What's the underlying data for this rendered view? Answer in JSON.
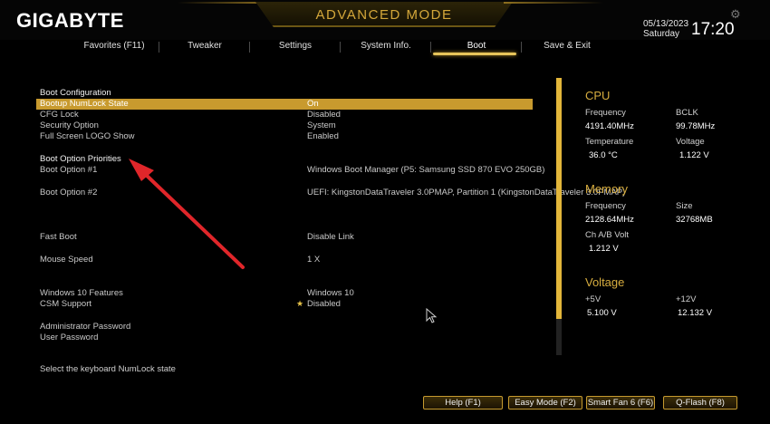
{
  "header": {
    "brand": "GIGABYTE",
    "mode_title": "ADVANCED MODE",
    "date": "05/13/2023",
    "day": "Saturday",
    "time": "17:20"
  },
  "tabs": [
    {
      "label": "Favorites (F11)",
      "active": false
    },
    {
      "label": "Tweaker",
      "active": false
    },
    {
      "label": "Settings",
      "active": false
    },
    {
      "label": "System Info.",
      "active": false
    },
    {
      "label": "Boot",
      "active": true
    },
    {
      "label": "Save & Exit",
      "active": false
    }
  ],
  "boot": {
    "section_config": "Boot Configuration",
    "items": [
      {
        "label": "Bootup NumLock State",
        "value": "On"
      },
      {
        "label": "CFG Lock",
        "value": "Disabled"
      },
      {
        "label": "Security Option",
        "value": "System"
      },
      {
        "label": "Full Screen LOGO Show",
        "value": "Enabled"
      }
    ],
    "section_priorities": "Boot Option Priorities",
    "boot_option_1": {
      "label": "Boot Option #1",
      "value": "Windows Boot Manager (P5: Samsung SSD 870 EVO 250GB)"
    },
    "boot_option_2": {
      "label": "Boot Option #2",
      "value": "UEFI: KingstonDataTraveler 3.0PMAP, Partition 1 (KingstonDataTraveler 3.0PMAP)"
    },
    "fast_boot": {
      "label": "Fast Boot",
      "value": "Disable Link"
    },
    "mouse_speed": {
      "label": "Mouse Speed",
      "value": "1 X"
    },
    "win10_features": {
      "label": "Windows 10 Features",
      "value": "Windows 10"
    },
    "csm_support": {
      "label": "CSM Support",
      "value": "Disabled"
    },
    "admin_password": {
      "label": "Administrator Password"
    },
    "user_password": {
      "label": "User Password"
    }
  },
  "help_text": "Select the keyboard NumLock state",
  "cpu": {
    "title": "CPU",
    "frequency_label": "Frequency",
    "frequency_value": "4191.40MHz",
    "bclk_label": "BCLK",
    "bclk_value": "99.78MHz",
    "temperature_label": "Temperature",
    "temperature_value": "36.0 °C",
    "voltage_label": "Voltage",
    "voltage_value": "1.122 V"
  },
  "memory": {
    "title": "Memory",
    "frequency_label": "Frequency",
    "frequency_value": "2128.64MHz",
    "size_label": "Size",
    "size_value": "32768MB",
    "ch_volt_label": "Ch A/B Volt",
    "ch_volt_value": "1.212 V"
  },
  "voltage": {
    "title": "Voltage",
    "v5_label": "+5V",
    "v5_value": "5.100 V",
    "v12_label": "+12V",
    "v12_value": "12.132 V"
  },
  "bottom_buttons": [
    "Help (F1)",
    "Easy Mode (F2)",
    "Smart Fan 6 (F6)",
    "Q-Flash (F8)"
  ],
  "colors": {
    "accent": "#c89a2e",
    "section_title": "#d7ad3f",
    "arrow": "#e0262a"
  },
  "icons": {
    "settings": "gear-icon",
    "annotation": "red-arrow",
    "pointer": "mouse-cursor-icon",
    "favorite": "star-icon"
  }
}
